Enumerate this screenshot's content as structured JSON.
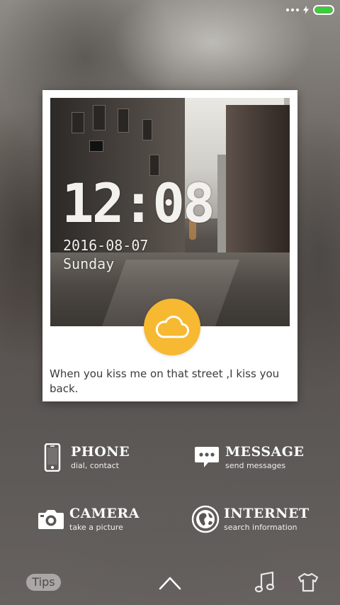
{
  "status_bar": {
    "battery_color": "#35d135"
  },
  "lock_card": {
    "time": "12:08",
    "date": "2016-08-07",
    "weekday": "Sunday",
    "weather_icon": "cloud-icon",
    "weather_color": "#f6b931",
    "quote": "When you kiss me on that street ,I kiss you back."
  },
  "shortcuts": {
    "phone": {
      "title": "PHONE",
      "subtitle": "dial, contact",
      "icon": "phone-icon"
    },
    "message": {
      "title": "MESSAGE",
      "subtitle": "send messages",
      "icon": "message-icon"
    },
    "camera": {
      "title": "CAMERA",
      "subtitle": "take a picture",
      "icon": "camera-icon"
    },
    "internet": {
      "title": "INTERNET",
      "subtitle": "search information",
      "icon": "globe-icon"
    }
  },
  "bottom_bar": {
    "tips_label": "Tips",
    "unlock_icon": "chevron-up-icon",
    "music_icon": "music-note-icon",
    "theme_icon": "tshirt-icon"
  }
}
